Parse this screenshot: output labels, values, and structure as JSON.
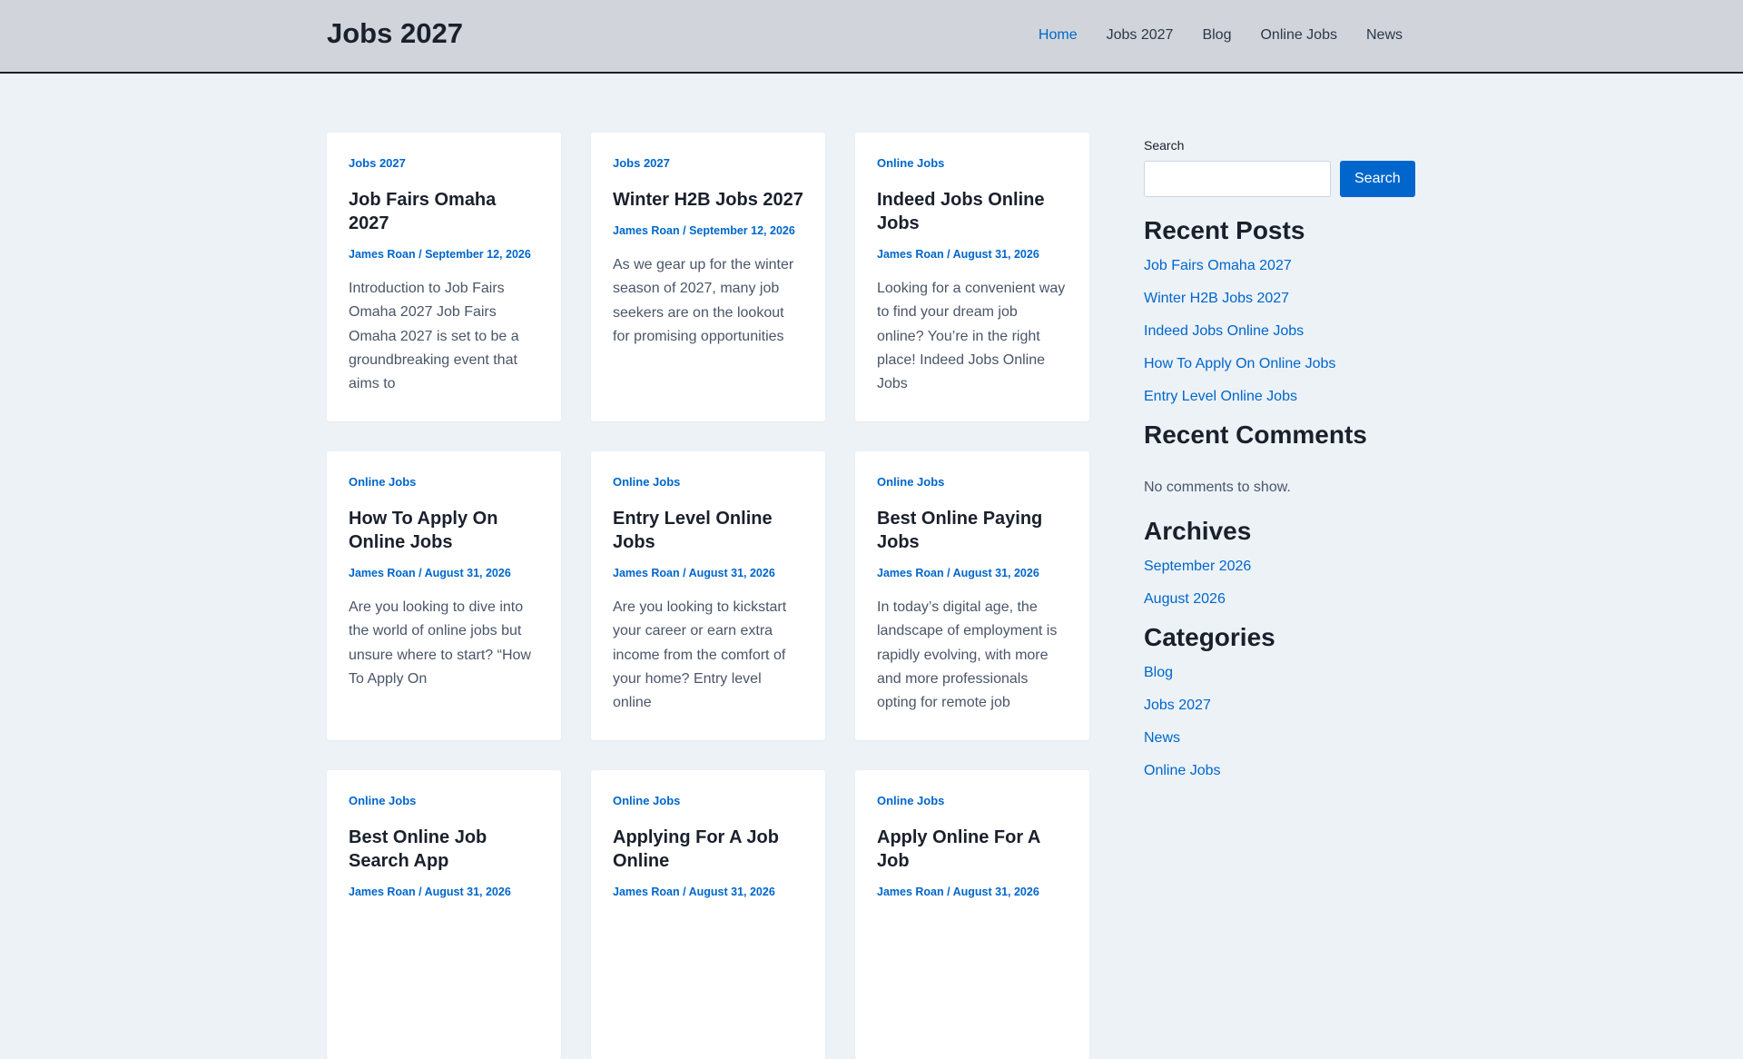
{
  "site": {
    "title": "Jobs 2027"
  },
  "nav": [
    "Home",
    "Jobs 2027",
    "Blog",
    "Online Jobs",
    "News"
  ],
  "posts": [
    {
      "category": "Jobs 2027",
      "title": "Job Fairs Omaha 2027",
      "meta": "James Roan / September 12, 2026",
      "excerpt": "Introduction to Job Fairs Omaha 2027 Job Fairs Omaha 2027 is set to be a groundbreaking event that aims to"
    },
    {
      "category": "Jobs 2027",
      "title": "Winter H2B Jobs 2027",
      "meta": "James Roan / September 12, 2026",
      "excerpt": "As we gear up for the winter season of 2027, many job seekers are on the lookout for promising opportunities"
    },
    {
      "category": "Online Jobs",
      "title": "Indeed Jobs Online Jobs",
      "meta": "James Roan / August 31, 2026",
      "excerpt": "Looking for a convenient way to find your dream job online? You’re in the right place! Indeed Jobs Online Jobs"
    },
    {
      "category": "Online Jobs",
      "title": "How To Apply On Online Jobs",
      "meta": "James Roan / August 31, 2026",
      "excerpt": "Are you looking to dive into the world of online jobs but unsure where to start? “How To Apply On"
    },
    {
      "category": "Online Jobs",
      "title": "Entry Level Online Jobs",
      "meta": "James Roan / August 31, 2026",
      "excerpt": "Are you looking to kickstart your career or earn extra income from the comfort of your home? Entry level online"
    },
    {
      "category": "Online Jobs",
      "title": "Best Online Paying Jobs",
      "meta": "James Roan / August 31, 2026",
      "excerpt": "In today’s digital age, the landscape of employment is rapidly evolving, with more and more professionals opting for remote job"
    },
    {
      "category": "Online Jobs",
      "title": "Best Online Job Search App",
      "meta": "James Roan / August 31, 2026",
      "excerpt": ""
    },
    {
      "category": "Online Jobs",
      "title": "Applying For A Job Online",
      "meta": "James Roan / August 31, 2026",
      "excerpt": ""
    },
    {
      "category": "Online Jobs",
      "title": "Apply Online For A Job",
      "meta": "James Roan / August 31, 2026",
      "excerpt": ""
    }
  ],
  "sidebar": {
    "search": {
      "label": "Search",
      "placeholder": "",
      "button": "Search"
    },
    "recent_posts": {
      "title": "Recent Posts",
      "items": [
        "Job Fairs Omaha 2027",
        "Winter H2B Jobs 2027",
        "Indeed Jobs Online Jobs",
        "How To Apply On Online Jobs",
        "Entry Level Online Jobs"
      ]
    },
    "recent_comments": {
      "title": "Recent Comments",
      "empty": "No comments to show."
    },
    "archives": {
      "title": "Archives",
      "items": [
        "September 2026",
        "August 2026"
      ]
    },
    "categories": {
      "title": "Categories",
      "items": [
        "Blog",
        "Jobs 2027",
        "News",
        "Online Jobs"
      ]
    }
  },
  "colors": {
    "accent": "#0066cc",
    "header_bg": "#d1d5db",
    "page_bg": "#edf2f7"
  }
}
